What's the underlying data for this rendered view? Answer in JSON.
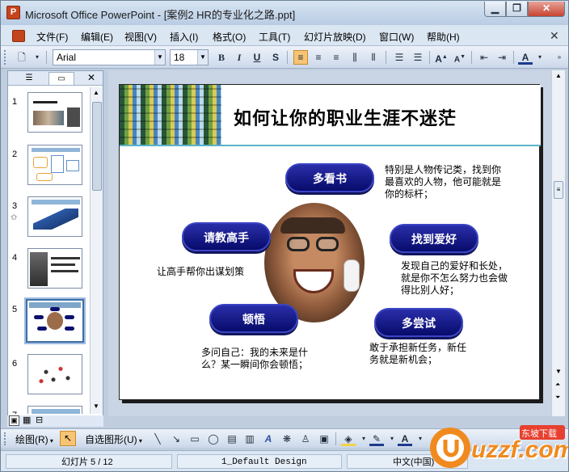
{
  "window": {
    "app_icon": "P",
    "title": "Microsoft Office PowerPoint - [案例2 HR的专业化之路.ppt]"
  },
  "menu": [
    "文件(F)",
    "编辑(E)",
    "视图(V)",
    "插入(I)",
    "格式(O)",
    "工具(T)",
    "幻灯片放映(D)",
    "窗口(W)",
    "帮助(H)"
  ],
  "toolbar": {
    "font": "Arial",
    "size": "18",
    "bold": "B",
    "italic": "I",
    "underline": "U",
    "shadow": "S"
  },
  "thumbnails": {
    "numbers": [
      "1",
      "2",
      "3",
      "4",
      "5",
      "6",
      "7"
    ],
    "selected": 5,
    "star_on": 3
  },
  "slide": {
    "title": "如何让你的职业生涯不迷茫",
    "pills": {
      "read_more": "多看书",
      "ask_expert": "请教高手",
      "find_hobby": "找到爱好",
      "enlighten": "顿悟",
      "try_more": "多尝试"
    },
    "desc": {
      "read_more": [
        "特别是人物传记类，找到你",
        "最喜欢的人物，他可能就是",
        "你的标杆；"
      ],
      "ask_expert": [
        "让高手帮你出谋划策"
      ],
      "find_hobby": [
        "发现自己的爱好和长处，",
        "就是你不怎么努力也会做",
        "得比别人好；"
      ],
      "enlighten": [
        "多问自己：我的未来是什",
        "么？某一瞬间你会顿悟；"
      ],
      "try_more": [
        "敢于承担新任务，新任",
        "务就是新机会；"
      ]
    }
  },
  "drawbar": {
    "draw_label": "绘图(R)",
    "autoshape_label": "自选图形(U)"
  },
  "status": {
    "slide_pos": "幻灯片 5 / 12",
    "design": "1_Default Design",
    "lang": "中文(中国)"
  },
  "watermark": {
    "brand": "uzzf.com",
    "badge": "东坡下载"
  },
  "colors": {
    "pill": "#070b6b",
    "title_bar": "#bfcddf",
    "accent_line": "#5bb3c9"
  }
}
